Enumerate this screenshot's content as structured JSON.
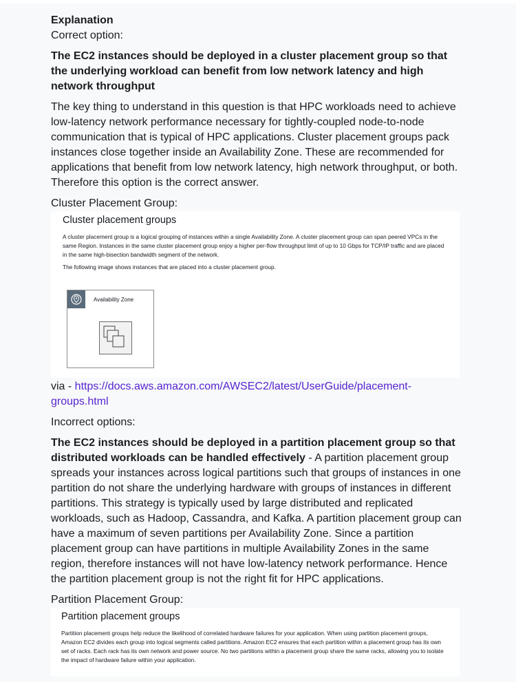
{
  "explanation": {
    "heading": "Explanation",
    "correct_label": "Correct option:",
    "correct_answer": "The EC2 instances should be deployed in a cluster placement group so that the underlying workload can benefit from low network latency and high network throughput",
    "correct_para": "The key thing to understand in this question is that HPC workloads need to achieve low-latency network performance necessary for tightly-coupled node-to-node communication that is typical of HPC applications. Cluster placement groups pack instances close together inside an Availability Zone. These are recommended for applications that benefit from low network latency, high network throughput, or both. Therefore this option is the correct answer.",
    "cluster_label": "Cluster Placement Group:",
    "cluster_img": {
      "title": "Cluster placement groups",
      "para1": "A cluster placement group is a logical grouping of instances within a single Availability Zone. A cluster placement group can span peered VPCs in the same Region. Instances in the same cluster placement group enjoy a higher per-flow throughput limit of up to 10 Gbps for TCP/IP traffic and are placed in the same high-bisection bandwidth segment of the network.",
      "para2": "The following image shows instances that are placed into a cluster placement group.",
      "az_label": "Availability Zone",
      "az_icon": "location-pin-icon",
      "instance_icon": "ec2-instances-icon"
    },
    "via_prefix": "via - ",
    "via_link": "https://docs.aws.amazon.com/AWSEC2/latest/UserGuide/placement-groups.html",
    "incorrect_label": "Incorrect options:",
    "incorrect_answer_bold": "The EC2 instances should be deployed in a partition placement group so that distributed workloads can be handled effectively",
    "incorrect_answer_text": " - A partition placement group spreads your instances across logical partitions such that groups of instances in one partition do not share the underlying hardware with groups of instances in different partitions. This strategy is typically used by large distributed and replicated workloads, such as Hadoop, Cassandra, and Kafka. A partition placement group can have a maximum of seven partitions per Availability Zone. Since a partition placement group can have partitions in multiple Availability Zones in the same region, therefore instances will not have low-latency network performance. Hence the partition placement group is not the right fit for HPC applications.",
    "partition_label": "Partition Placement Group:",
    "partition_img": {
      "title": "Partition placement groups",
      "para1": "Partition placement groups help reduce the likelihood of correlated hardware failures for your application. When using partition placement groups, Amazon EC2 divides each group into logical segments called partitions. Amazon EC2 ensures that each partition within a placement group has its own set of racks. Each rack has its own network and power source. No two partitions within a placement group share the same racks, allowing you to isolate the impact of hardware failure within your application."
    }
  },
  "colors": {
    "link": "#5624d0",
    "panel_bg": "#f7f9fa",
    "text": "#1c1d1f"
  }
}
